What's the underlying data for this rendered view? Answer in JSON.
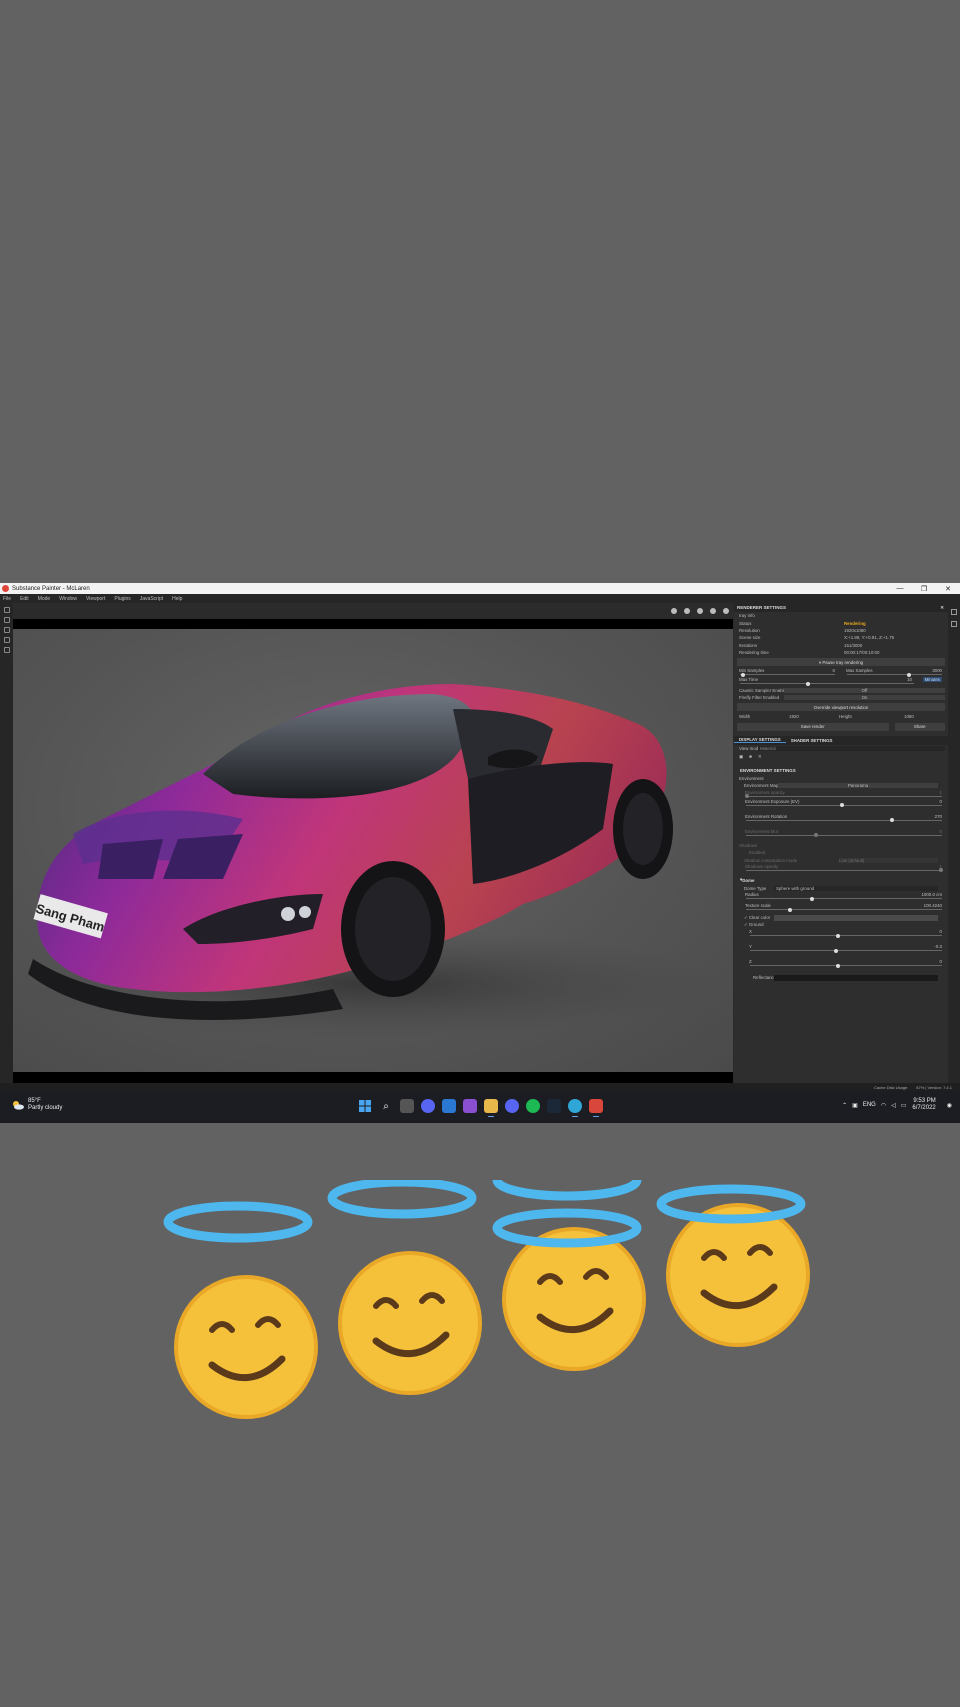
{
  "window": {
    "title": "Substance Painter - McLaren",
    "controls": [
      "—",
      "❐",
      "✕"
    ]
  },
  "menu": [
    "File",
    "Edit",
    "Mode",
    "Window",
    "Viewport",
    "Plugins",
    "JavaScript",
    "Help"
  ],
  "viewport": {
    "watermark": "Sang Pham"
  },
  "render_panel": {
    "header": "RENDERER SETTINGS",
    "section": "Iray Info",
    "info": [
      {
        "label": "Status",
        "value": "Rendering"
      },
      {
        "label": "Resolution",
        "value": "1920x1080"
      },
      {
        "label": "Scene size",
        "value": "X:+1.89, Y:+0.91, Z:+1.75"
      },
      {
        "label": "Iterations",
        "value": "161/3000"
      },
      {
        "label": "Rendering time",
        "value": "00:00:17/00:10:00"
      }
    ],
    "pause_button": "⏸ Pause Iray rendering",
    "min_samples": {
      "label": "Min Samples",
      "value": "0"
    },
    "max_samples": {
      "label": "Max Samples",
      "value": "3000"
    },
    "max_time": {
      "label": "Max Time",
      "value": "10",
      "unit": "Minutes"
    },
    "caustic": {
      "label": "Caustic Sampler Enabled",
      "value": "Off"
    },
    "firefly": {
      "label": "Firefly Filter Enabled",
      "value": "On"
    },
    "override_button": "Override viewport resolution",
    "width": {
      "label": "Width",
      "value": "1920"
    },
    "height": {
      "label": "Height",
      "value": "1080"
    },
    "save_button": "Save render",
    "share_button": "Share"
  },
  "display_panel": {
    "tabs": [
      "DISPLAY SETTINGS",
      "SHADER SETTINGS"
    ],
    "view_mode": {
      "label": "View mode",
      "value": "Material"
    },
    "section": "ENVIRONMENT SETTINGS",
    "env_label": "Environment",
    "env_map": {
      "label": "Environment Map",
      "value": "Panorama"
    },
    "env_opacity": {
      "label": "Environment opacity",
      "value": "1"
    },
    "env_exposure": {
      "label": "Environment Exposure (EV)",
      "value": "0"
    },
    "env_rotation": {
      "label": "Environment Rotation",
      "value": "270"
    },
    "env_blur": {
      "label": "Environment blur",
      "value": "0"
    },
    "shadows": "Shadows",
    "shadow_enabled": "Enabled",
    "shadow_mode": {
      "label": "Shadow computation mode",
      "value": "Low (default)"
    },
    "shadow_opacity": {
      "label": "Shadows opacity",
      "value": "1"
    },
    "dome": "Dome",
    "dome_type": {
      "label": "Dome Type",
      "value": "Sphere with ground"
    },
    "radius": {
      "label": "Radius",
      "value": "1000.0 cm"
    },
    "texture_scale": {
      "label": "Texture scale",
      "value": "100.4240"
    },
    "clear_color": "Clear color",
    "ground": "Ground",
    "ground_x": {
      "label": "X",
      "value": "0"
    },
    "ground_y": {
      "label": "Y",
      "value": "-0.3"
    },
    "ground_z": {
      "label": "Z",
      "value": "0"
    },
    "reflectance": "Reflectance"
  },
  "statusbar": [
    "Cache Disk Usage:",
    "87% | Version: 7.4.1"
  ],
  "taskbar": {
    "weather_temp": "85°F",
    "weather_desc": "Partly cloudy",
    "language": "ENG",
    "time": "9:53 PM",
    "date": "6/7/2022"
  }
}
